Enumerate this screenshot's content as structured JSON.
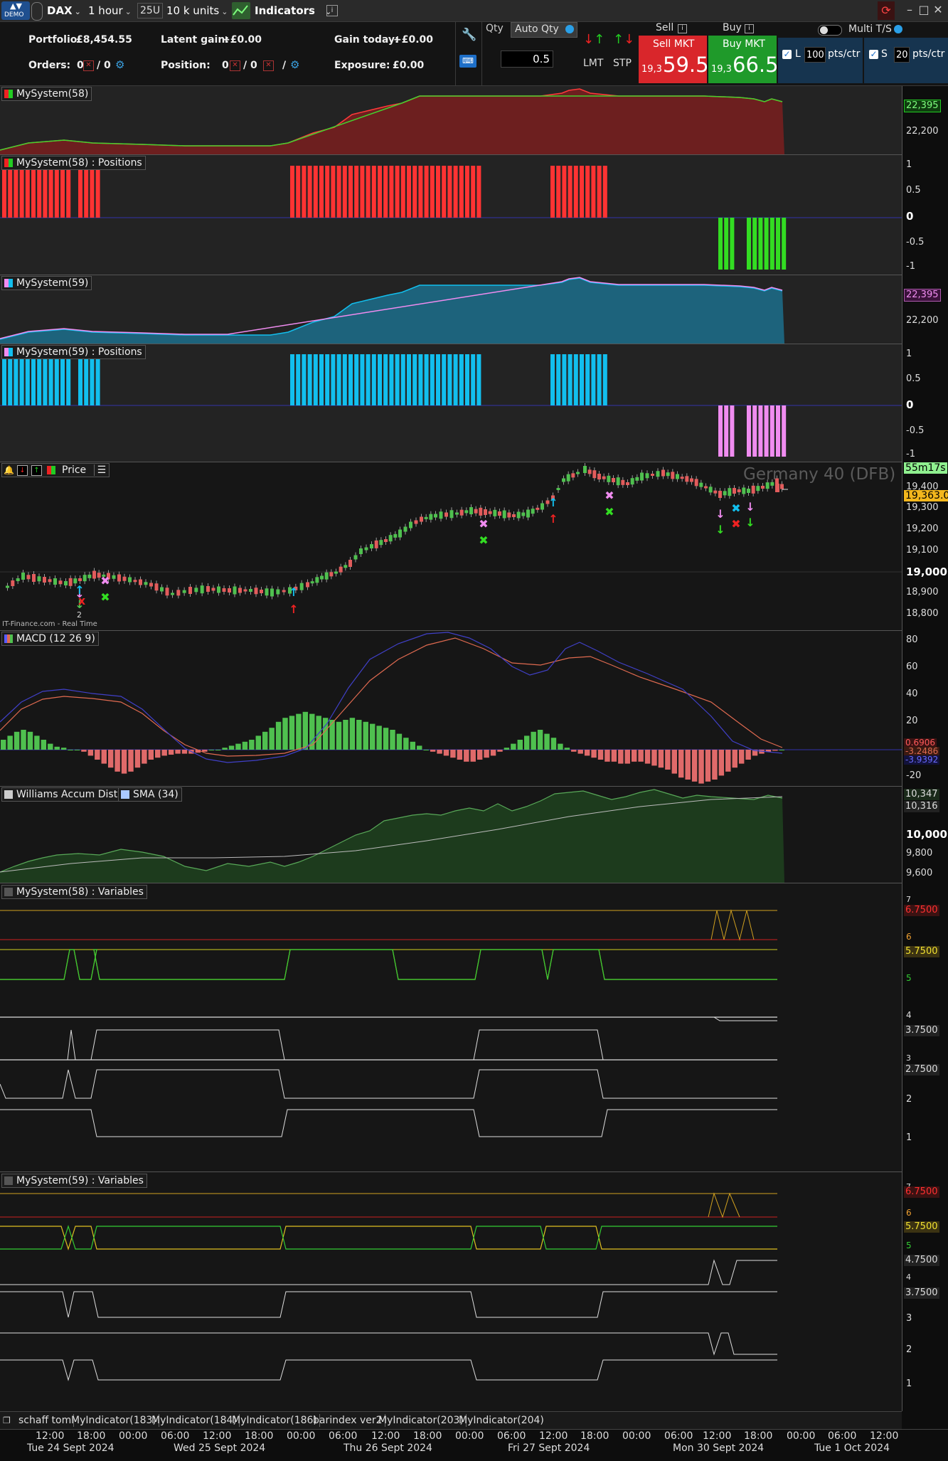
{
  "toolbar": {
    "demo_badge": "DEMO",
    "instrument": "DAX",
    "timeframe": "1 hour",
    "units_count": "25U",
    "units": "10 k units",
    "indicators_label": "Indicators"
  },
  "account": {
    "portfolio_label": "Portfolio:",
    "portfolio_value": "£8,454.55",
    "latent_label": "Latent gain:",
    "latent_value": "+£0.00",
    "gain_today_label": "Gain today:",
    "gain_today_value": "+£0.00",
    "orders_label": "Orders:",
    "orders_a": "0",
    "orders_b": "/ 0",
    "position_label": "Position:",
    "position_a": "0",
    "position_b": "/ 0",
    "position_c": "/",
    "exposure_label": "Exposure:",
    "exposure_value": "£0.00"
  },
  "order_ticket": {
    "qty_label": "Qty",
    "auto_qty_label": "Auto Qty",
    "qty_value": "0.5",
    "lmt_label": "LMT",
    "stp_label": "STP",
    "sell_header": "Sell",
    "buy_header": "Buy",
    "sell_button": "Sell MKT",
    "buy_button": "Buy MKT",
    "sell_price_small": "19,3",
    "sell_price_big": "59.5",
    "buy_price_small": "19,3",
    "buy_price_big": "66.5",
    "multi_ts_label": "Multi T/S",
    "limit_check": "L",
    "limit_value": "100",
    "limit_unit": "pts/ctr",
    "stop_check": "S",
    "stop_value": "20",
    "stop_unit": "pts/ctr"
  },
  "panels": {
    "sys58": {
      "title": "MySystem(58)",
      "ticks": [
        "22,200"
      ],
      "badge": "22,395"
    },
    "pos58": {
      "title": "MySystem(58) : Positions",
      "ticks": [
        "1",
        "0.5",
        "0",
        "-0.5",
        "-1"
      ]
    },
    "sys59": {
      "title": "MySystem(59)",
      "ticks": [
        "22,200"
      ],
      "badge": "22,395"
    },
    "pos59": {
      "title": "MySystem(59) : Positions",
      "ticks": [
        "1",
        "0.5",
        "0",
        "-0.5",
        "-1"
      ]
    },
    "price": {
      "title": "Price",
      "watermark": "Germany 40 (DFB)",
      "timer": "55m17s",
      "ticks": [
        "19,400",
        "19,300",
        "19,200",
        "19,100",
        "19,000",
        "18,900",
        "18,800"
      ],
      "last": "19,363.0",
      "source": "IT-Finance.com - Real Time",
      "count_label": "2"
    },
    "macd": {
      "title": "MACD (12 26 9)",
      "ticks": [
        "80",
        "60",
        "40",
        "20",
        "-20"
      ],
      "badges": [
        "0.6906",
        "-3.2486",
        "-3.9392"
      ]
    },
    "williams": {
      "title": "Williams Accum Distr",
      "sma_title": "SMA (34)",
      "ticks": [
        "10,000",
        "9,800",
        "9,600"
      ],
      "badges": [
        "10,347",
        "10,316"
      ]
    },
    "var58": {
      "title": "MySystem(58) : Variables",
      "ticks": [
        "7",
        "6",
        "5",
        "4",
        "3",
        "2",
        "1"
      ],
      "badges": [
        "6.7500",
        "5.7500",
        "3.7500",
        "2.7500"
      ]
    },
    "var59": {
      "title": "MySystem(59) : Variables",
      "ticks": [
        "7",
        "6",
        "5",
        "4",
        "3",
        "2",
        "1"
      ],
      "badges": [
        "6.7500",
        "5.7500",
        "4.7500",
        "3.7500"
      ]
    }
  },
  "tabs": [
    "schaff tom",
    "MyIndicator(183)",
    "MyIndicator(184)",
    "MyIndicator(186)",
    "barindex ver2",
    "MyIndicator(203)",
    "MyIndicator(204)"
  ],
  "time_axis": {
    "times": [
      "12:00",
      "18:00",
      "00:00",
      "06:00",
      "12:00",
      "18:00",
      "00:00",
      "06:00",
      "12:00",
      "18:00",
      "00:00",
      "06:00",
      "12:00",
      "18:00",
      "00:00",
      "06:00",
      "12:00",
      "18:00",
      "00:00",
      "06:00",
      "12:00"
    ],
    "dates": [
      "Tue 24 Sept 2024",
      "Wed 25 Sept 2024",
      "Thu 26 Sept 2024",
      "Fri 27 Sept 2024",
      "Mon 30 Sept 2024",
      "Tue 1 Oct 2024"
    ]
  },
  "colors": {
    "sell_red": "#d9262b",
    "buy_green": "#1f9a2a",
    "short_bar_red": "#ff3333",
    "long_bar_green": "#33dd22",
    "cyan_bar": "#12bfee",
    "pink_bar": "#f08cf0",
    "macd_line": "#4040c8",
    "signal_line": "#e06a50",
    "accent_blue": "#1a3a5a"
  }
}
